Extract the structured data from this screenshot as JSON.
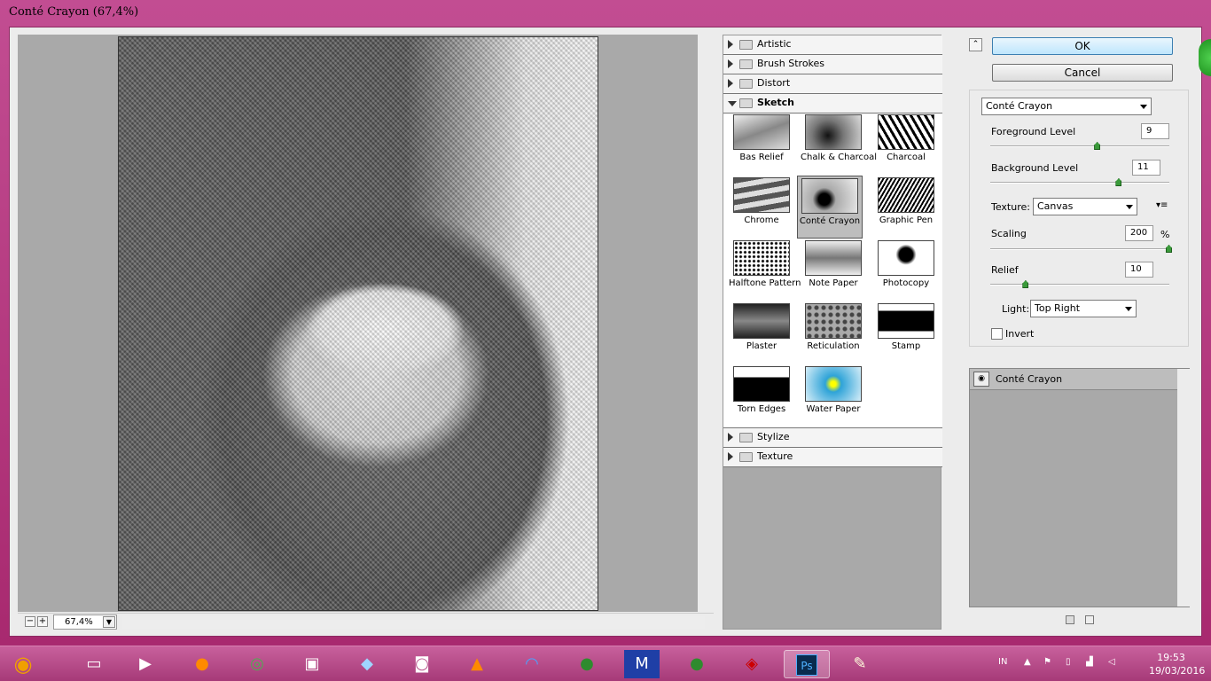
{
  "window": {
    "title": "Conté Crayon (67,4%)"
  },
  "preview": {
    "zoom": "67,4%",
    "zoom_out": "−",
    "zoom_in": "+"
  },
  "gallery": {
    "categories_top": [
      "Artistic",
      "Brush Strokes",
      "Distort"
    ],
    "open_category": "Sketch",
    "thumbnails": [
      {
        "label": "Bas Relief"
      },
      {
        "label": "Chalk & Charcoal"
      },
      {
        "label": "Charcoal"
      },
      {
        "label": "Chrome"
      },
      {
        "label": "Conté Crayon"
      },
      {
        "label": "Graphic Pen"
      },
      {
        "label": "Halftone Pattern"
      },
      {
        "label": "Note Paper"
      },
      {
        "label": "Photocopy"
      },
      {
        "label": "Plaster"
      },
      {
        "label": "Reticulation"
      },
      {
        "label": "Stamp"
      },
      {
        "label": "Torn Edges"
      },
      {
        "label": "Water Paper"
      }
    ],
    "selected": "Conté Crayon",
    "categories_bottom": [
      "Stylize",
      "Texture"
    ]
  },
  "buttons": {
    "ok": "OK",
    "cancel": "Cancel"
  },
  "settings": {
    "filter": "Conté Crayon",
    "foreground_label": "Foreground Level",
    "foreground_value": "9",
    "foreground_fraction": 0.6,
    "background_label": "Background Level",
    "background_value": "11",
    "background_fraction": 0.72,
    "texture_label": "Texture:",
    "texture_value": "Canvas",
    "scaling_label": "Scaling",
    "scaling_value": "200",
    "scaling_unit": "%",
    "scaling_fraction": 1.0,
    "relief_label": "Relief",
    "relief_value": "10",
    "relief_fraction": 0.2,
    "light_label": "Light:",
    "light_value": "Top Right",
    "invert_label": "Invert",
    "invert_checked": false
  },
  "layers": {
    "items": [
      {
        "name": "Conté Crayon"
      }
    ]
  },
  "taskbar": {
    "language": "IN",
    "time": "19:53",
    "date": "19/03/2016",
    "apps": [
      "start",
      "explorer",
      "media",
      "firefox",
      "chrome",
      "terminal",
      "notes",
      "camera",
      "vlc",
      "wifi",
      "app-green-1",
      "app-m",
      "app-green-2",
      "app-eye",
      "photoshop",
      "paint"
    ]
  }
}
